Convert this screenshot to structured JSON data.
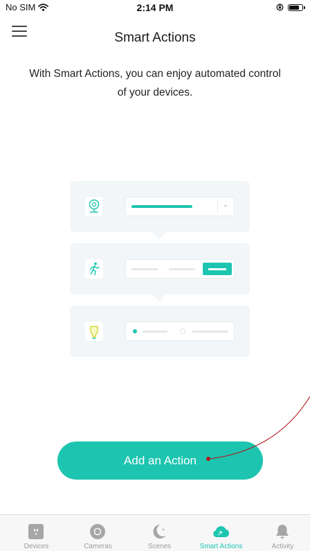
{
  "status_bar": {
    "carrier": "No SIM",
    "time": "2:14 PM",
    "battery_level": 0.85
  },
  "header": {
    "title": "Smart Actions"
  },
  "intro_text": "With Smart Actions, you can enjoy automated control of your devices.",
  "add_button": {
    "label": "Add an Action"
  },
  "tabs": [
    {
      "label": "Devices",
      "icon": "plug-icon",
      "active": false
    },
    {
      "label": "Cameras",
      "icon": "camera-lens-icon",
      "active": false
    },
    {
      "label": "Scenes",
      "icon": "moon-icon",
      "active": false
    },
    {
      "label": "Smart Actions",
      "icon": "cloud-sparkle-icon",
      "active": true
    },
    {
      "label": "Activity",
      "icon": "bell-icon",
      "active": false
    }
  ],
  "colors": {
    "accent": "#1dc5b0",
    "inactive": "#9b9b9b",
    "annotation": "#b5121b",
    "illustration_bg": "#f2f6f8"
  }
}
